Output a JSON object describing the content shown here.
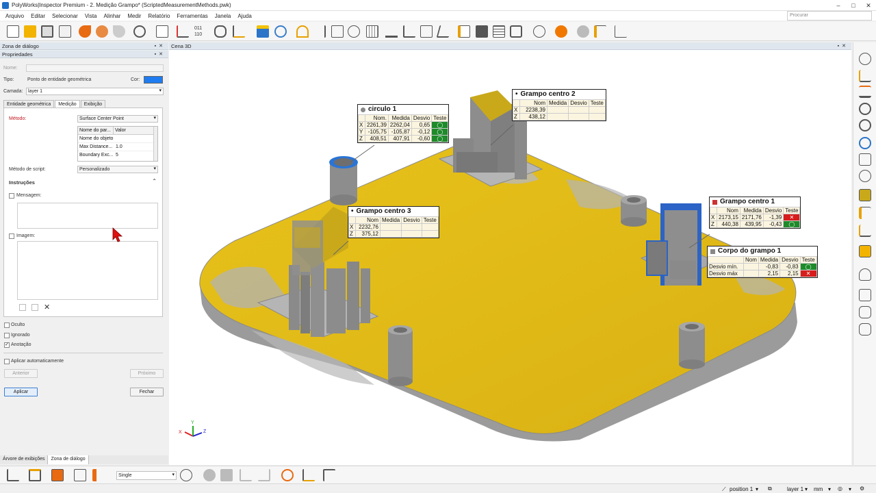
{
  "window": {
    "title": "PolyWorks|Inspector Premium - 2. Medição Grampo* (ScriptedMeasurementMethods.pwk)",
    "controls": [
      "–",
      "□",
      "✕"
    ]
  },
  "menu": [
    "Arquivo",
    "Editar",
    "Selecionar",
    "Vista",
    "Alinhar",
    "Medir",
    "Relatório",
    "Ferramentas",
    "Janela",
    "Ajuda"
  ],
  "search": {
    "placeholder": "Procurar"
  },
  "toolbar_icons": [
    "new-icon",
    "open-icon",
    "save-icon",
    "export-icon",
    "undo-icon",
    "undo-menu-icon",
    "redo-icon",
    "settings-icon",
    "copy-icon",
    "probe-icon",
    "binary-icon",
    "cube-icon",
    "align-icon",
    "object-icon",
    "select-icon",
    "brush-icon",
    "line-icon",
    "compare-icon",
    "measure-icon",
    "grid-icon",
    "surface-icon",
    "section-icon",
    "gauge-icon",
    "feature-icon",
    "report-icon",
    "snapshot-icon",
    "table-icon",
    "camera-icon",
    "macro-icon",
    "play-icon",
    "stop-icon",
    "sequence-icon",
    "chart-icon"
  ],
  "panels": {
    "dialog_zone": {
      "title": "Zona de diálogo",
      "buttons": [
        "▪",
        "✕"
      ]
    },
    "properties": {
      "title": "Propriedades",
      "buttons": [
        "▪",
        "✕"
      ]
    }
  },
  "props": {
    "name_label": "Nome:",
    "type_label": "Tipo:",
    "type_value": "Ponto de entidade geométrica",
    "color_label": "Cor:",
    "color_value": "#1e7cf0",
    "layer_label": "Camada:",
    "layer_value": "layer 1"
  },
  "tabs": [
    {
      "label": "Entidade geométrica",
      "active": false
    },
    {
      "label": "Medição",
      "active": true
    },
    {
      "label": "Exibição",
      "active": false
    }
  ],
  "measurement": {
    "method_label": "Método:",
    "method_value": "Surface Center Point",
    "param_headers": [
      "Nome do par...",
      "Valor"
    ],
    "params": [
      {
        "name": "Nome do objeto",
        "value": ""
      },
      {
        "name": "Max Distance...",
        "value": "1.0"
      },
      {
        "name": "Boundary Exc...",
        "value": "5"
      }
    ],
    "script_method_label": "Método de script:",
    "script_method_value": "Personalizado",
    "instructions_title": "Instruções",
    "message_label": "Mensagem:",
    "image_label": "Imagem:"
  },
  "flags": [
    {
      "label": "Oculto",
      "checked": false
    },
    {
      "label": "Ignorado",
      "checked": false
    },
    {
      "label": "Anotação",
      "checked": true
    }
  ],
  "auto_apply_label": "Aplicar automaticamente",
  "buttons": {
    "previous": "Anterior",
    "next": "Próximo",
    "apply": "Aplicar",
    "close": "Fechar"
  },
  "bottom_tabs": [
    "Árvore de exibições",
    "Zona de diálogo"
  ],
  "viewport": {
    "title": "Cena 3D",
    "buttons": [
      "▪",
      "✕"
    ]
  },
  "axis_triad": {
    "x": "X",
    "y": "Y",
    "z": "Z"
  },
  "annotations": [
    {
      "title": "circulo 1",
      "headers": [
        "",
        "Nom.",
        "Medida",
        "Desvio",
        "Teste"
      ],
      "rows": [
        {
          "axis": "X",
          "nom": "2261,39",
          "measured": "2262,04",
          "dev": "0,65",
          "test": "pass"
        },
        {
          "axis": "Y",
          "nom": "-105,75",
          "measured": "-105,87",
          "dev": "-0,12",
          "test": "pass"
        },
        {
          "axis": "Z",
          "nom": "408,51",
          "measured": "407,91",
          "dev": "-0,60",
          "test": "pass"
        }
      ]
    },
    {
      "title": "Grampo centro 2",
      "headers": [
        "",
        "Nom",
        "Medida",
        "Desvio",
        "Teste"
      ],
      "rows": [
        {
          "axis": "X",
          "nom": "2238,39",
          "measured": "",
          "dev": "",
          "test": ""
        },
        {
          "axis": "Z",
          "nom": "438,12",
          "measured": "",
          "dev": "",
          "test": ""
        }
      ]
    },
    {
      "title": "Grampo centro 3",
      "headers": [
        "",
        "Nom",
        "Medida",
        "Desvio",
        "Teste"
      ],
      "rows": [
        {
          "axis": "X",
          "nom": "2232,76",
          "measured": "",
          "dev": "",
          "test": ""
        },
        {
          "axis": "Z",
          "nom": "375,12",
          "measured": "",
          "dev": "",
          "test": ""
        }
      ]
    },
    {
      "title": "Grampo centro 1",
      "headers": [
        "",
        "Nom",
        "Medida",
        "Desvio",
        "Teste"
      ],
      "rows": [
        {
          "axis": "X",
          "nom": "2173,15",
          "measured": "2171,76",
          "dev": "-1,39",
          "test": "fail"
        },
        {
          "axis": "Z",
          "nom": "440,38",
          "measured": "439,95",
          "dev": "-0,43",
          "test": "pass"
        }
      ]
    },
    {
      "title": "Corpo do grampo 1",
      "headers": [
        "",
        "Nom",
        "Medida",
        "Desvio",
        "Teste"
      ],
      "rows": [
        {
          "axis": "Desvio mín.",
          "nom": "",
          "measured": "-0,83",
          "dev": "-0,83",
          "test": "pass"
        },
        {
          "axis": "Desvio máx",
          "nom": "",
          "measured": "2,15",
          "dev": "2,15",
          "test": "fail"
        }
      ]
    }
  ],
  "bottom_toolbar": {
    "mode_value": "Single"
  },
  "status": {
    "position": "position 1",
    "layer": "layer 1",
    "units": "mm"
  },
  "colors": {
    "deviation_yellow": "#e3be14",
    "model_gray": "#a9a9a9",
    "pass": "#1e8a2a",
    "fail": "#d71c1c",
    "accent": "#1f6fc5"
  }
}
